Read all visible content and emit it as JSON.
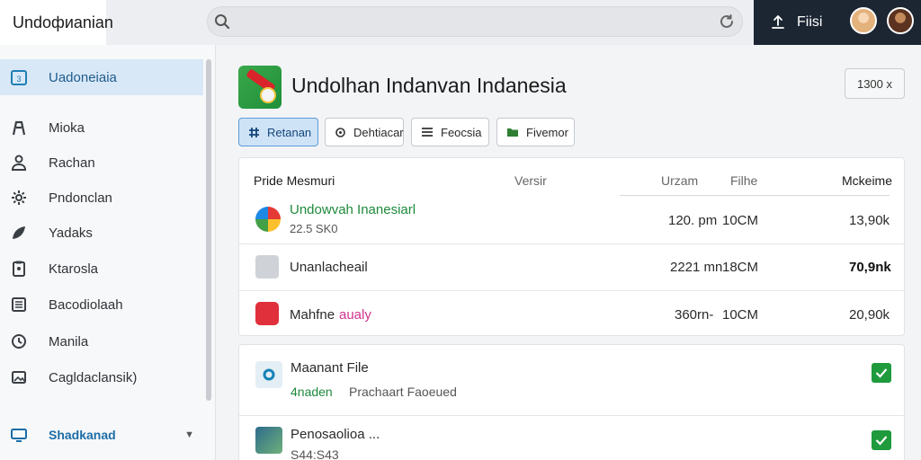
{
  "topbar": {
    "brand": "Undoфиanian",
    "search": {
      "value": "",
      "placeholder": ""
    },
    "user_label": "Fiisi"
  },
  "sidebar": {
    "items": [
      {
        "label": "Uadoneiaia",
        "icon": "calendar-icon"
      },
      {
        "label": "Mioka",
        "icon": "person-icon"
      },
      {
        "label": "Rachan",
        "icon": "user-icon"
      },
      {
        "label": "Pndonclan",
        "icon": "gear-icon"
      },
      {
        "label": "Yadaks",
        "icon": "leaf-icon"
      },
      {
        "label": "Ktarosla",
        "icon": "clipboard-icon"
      },
      {
        "label": "Bacodiolaah",
        "icon": "list-icon"
      },
      {
        "label": "Manila",
        "icon": "clock-icon"
      },
      {
        "label": "Cagldaclansik)",
        "icon": "image-icon"
      }
    ],
    "footer": {
      "label": "Shadkanad",
      "icon": "monitor-icon"
    }
  },
  "main": {
    "title": "Undolhan Indanvan Indanesia",
    "top_button": "1300 x",
    "tabs": [
      {
        "label": "Retanan",
        "icon": "grid-icon"
      },
      {
        "label": "Dehtiacar",
        "icon": "refresh-icon"
      },
      {
        "label": "Feocsia",
        "icon": "list-icon"
      },
      {
        "label": "Fivemor",
        "icon": "folder-icon"
      }
    ]
  },
  "table": {
    "columns": [
      "Pride Mesmuri",
      "Versir",
      "Urzam",
      "Filhe",
      "Mckeime"
    ],
    "rows": [
      {
        "name": "Undowvah Inanesiarl",
        "sub": "22.5 SK0",
        "time": "120. pm",
        "size": "10СM",
        "value": "13,90k",
        "icon": "colorful-app-icon"
      },
      {
        "name": "Unanlacheail",
        "sub": "",
        "time": "2221 mn",
        "size": "18CM",
        "value": "70,9nk",
        "icon": "placeholder-image-icon"
      },
      {
        "name": "Mahfne",
        "name_extra": "aualy",
        "sub": "",
        "time": "360rn-",
        "size": "10CM",
        "value": "20,90k",
        "icon": "red-app-icon"
      }
    ]
  },
  "files": {
    "items": [
      {
        "name": "Maanant File",
        "status_prefix": "4naden",
        "status": "Prachaart Faoeued",
        "checked": true
      },
      {
        "name": "Penosaolioa ...",
        "sub": "S44:S43",
        "checked": true
      }
    ]
  }
}
